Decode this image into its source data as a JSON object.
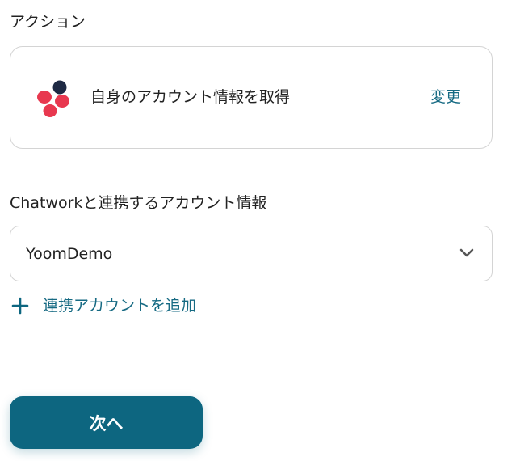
{
  "action": {
    "section_label": "アクション",
    "app_icon": "chatwork-logo-icon",
    "name": "自身のアカウント情報を取得",
    "change_label": "変更"
  },
  "account": {
    "section_label": "Chatworkと連携するアカウント情報",
    "selected_value": "YoomDemo",
    "dropdown_icon": "chevron-down-icon",
    "add_icon": "plus-icon",
    "add_label": "連携アカウントを追加"
  },
  "footer": {
    "next_label": "次へ"
  },
  "colors": {
    "accent": "#0d6680",
    "link": "#166a83",
    "logo_red": "#e8384f",
    "logo_dark": "#1e2a44",
    "border": "#d4d4d4"
  }
}
